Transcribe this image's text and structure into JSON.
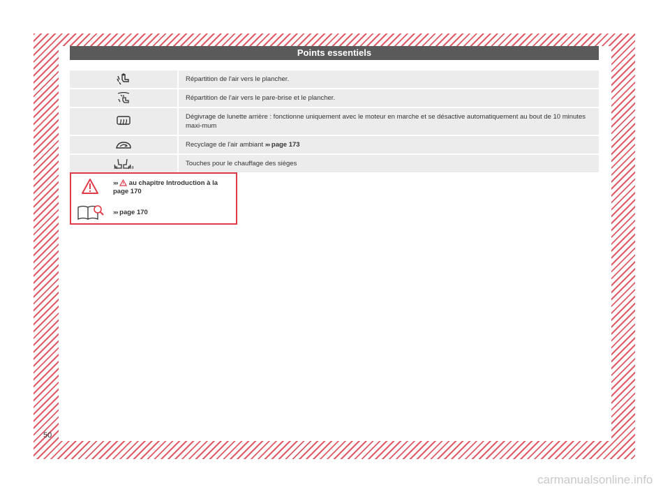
{
  "header": {
    "title": "Points essentiels"
  },
  "rows": [
    {
      "icon": "floor-air-icon",
      "text": "Répartition de l'air vers le plancher."
    },
    {
      "icon": "windshield-floor-air-icon",
      "text": "Répartition de l'air vers le pare-brise et le plancher."
    },
    {
      "icon": "rear-defrost-icon",
      "text": "Dégivrage de lunette arrière : fonctionne uniquement avec le moteur en marche et se désactive automatiquement au bout de 10 minutes maxi-mum"
    },
    {
      "icon": "recirculation-icon",
      "text": "Recyclage de l'air ambiant",
      "ref_arrows": "›››",
      "ref": "page 173"
    },
    {
      "icon": "seat-heating-icon",
      "text": "Touches pour le chauffage des sièges"
    }
  ],
  "warning": {
    "arrows": "›››",
    "text": "au chapitre Introduction à la page 170",
    "ref_arrows": "›››",
    "ref": "page 170"
  },
  "footer": {
    "page_number": "50"
  },
  "watermark": "carmanualsonline.info",
  "colors": {
    "accent": "#e03a4a",
    "header_bg": "#5a5a5a",
    "row_bg": "#ececec"
  }
}
